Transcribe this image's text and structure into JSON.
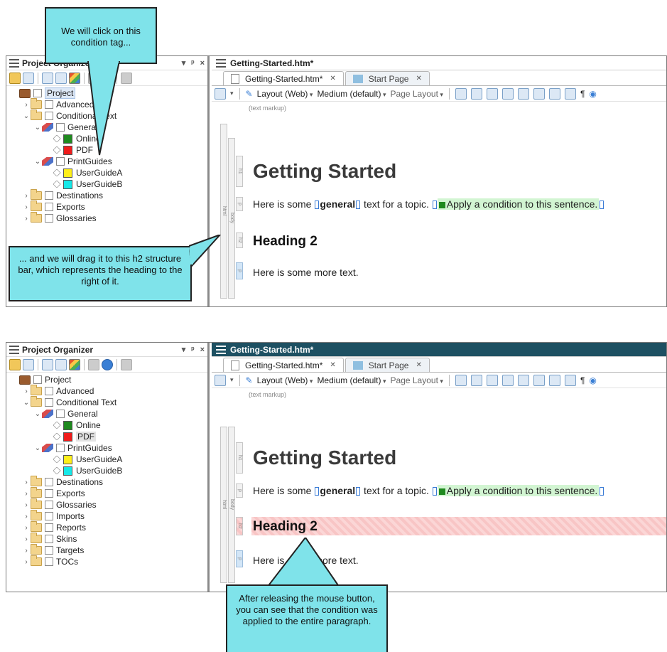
{
  "panels": [
    {
      "organizer": {
        "title": "Project Organizer",
        "pin": "ᵖ",
        "close": "×"
      },
      "tree": [
        {
          "label": "Project",
          "level": 0,
          "icon": "briefcase",
          "expanded": null
        },
        {
          "label": "Advanced",
          "level": 1,
          "icon": "folder",
          "expanded": false
        },
        {
          "label": "Conditional Text",
          "level": 1,
          "icon": "folder",
          "expanded": true
        },
        {
          "label": "General",
          "level": 2,
          "icon": "tagset",
          "expanded": true
        },
        {
          "label": "Online",
          "level": 3,
          "icon": "tag",
          "swatch": "#1f8a1f"
        },
        {
          "label": "PDF",
          "level": 3,
          "icon": "tag",
          "swatch": "#ef1c1c"
        },
        {
          "label": "PrintGuides",
          "level": 2,
          "icon": "tagset",
          "expanded": true
        },
        {
          "label": "UserGuideA",
          "level": 3,
          "icon": "tag",
          "swatch": "#ffef1a"
        },
        {
          "label": "UserGuideB",
          "level": 3,
          "icon": "tag",
          "swatch": "#16e8e8"
        },
        {
          "label": "Destinations",
          "level": 1,
          "icon": "folder",
          "expanded": false
        },
        {
          "label": "Exports",
          "level": 1,
          "icon": "folder",
          "expanded": false
        },
        {
          "label": "Glossaries",
          "level": 1,
          "icon": "folder",
          "expanded": false
        }
      ],
      "doc": {
        "header_title": "Getting-Started.htm*",
        "tab_active": "Getting-Started.htm*",
        "tab_inactive": "Start Page",
        "toolbar": {
          "layout": "Layout (Web)",
          "medium": "Medium (default)",
          "page_layout": "Page Layout",
          "pilcrow": "¶"
        },
        "markup_label": "(text markup)",
        "struct_labels": {
          "html": "html",
          "body": "body",
          "h1": "h1",
          "p": "p",
          "h2": "h2"
        },
        "h1": "Getting Started",
        "p1_before": "Here is some ",
        "p1_bold": "general",
        "p1_after": " text for a topic. ",
        "p1_cond": "Apply a condition to this sentence.",
        "h2": "Heading 2",
        "p2": "Here is some more text."
      },
      "callouts": {
        "top": "We will click on this condition tag...",
        "bottom": "... and we will drag it to this h2 structure bar, which represents the heading to the right of it."
      }
    },
    {
      "organizer": {
        "title": "Project Organizer",
        "pin": "ᵖ",
        "close": "×"
      },
      "tree": [
        {
          "label": "Project",
          "level": 0,
          "icon": "briefcase",
          "expanded": null
        },
        {
          "label": "Advanced",
          "level": 1,
          "icon": "folder",
          "expanded": false
        },
        {
          "label": "Conditional Text",
          "level": 1,
          "icon": "folder",
          "expanded": true
        },
        {
          "label": "General",
          "level": 2,
          "icon": "tagset",
          "expanded": true
        },
        {
          "label": "Online",
          "level": 3,
          "icon": "tag",
          "swatch": "#1f8a1f"
        },
        {
          "label": "PDF",
          "level": 3,
          "icon": "tag",
          "swatch": "#ef1c1c"
        },
        {
          "label": "PrintGuides",
          "level": 2,
          "icon": "tagset",
          "expanded": true
        },
        {
          "label": "UserGuideA",
          "level": 3,
          "icon": "tag",
          "swatch": "#ffef1a"
        },
        {
          "label": "UserGuideB",
          "level": 3,
          "icon": "tag",
          "swatch": "#16e8e8"
        },
        {
          "label": "Destinations",
          "level": 1,
          "icon": "folder",
          "expanded": false
        },
        {
          "label": "Exports",
          "level": 1,
          "icon": "folder",
          "expanded": false
        },
        {
          "label": "Glossaries",
          "level": 1,
          "icon": "folder",
          "expanded": false
        },
        {
          "label": "Imports",
          "level": 1,
          "icon": "folder",
          "expanded": false
        },
        {
          "label": "Reports",
          "level": 1,
          "icon": "folder",
          "expanded": false
        },
        {
          "label": "Skins",
          "level": 1,
          "icon": "folder",
          "expanded": false
        },
        {
          "label": "Targets",
          "level": 1,
          "icon": "folder",
          "expanded": false
        },
        {
          "label": "TOCs",
          "level": 1,
          "icon": "folder",
          "expanded": false
        }
      ],
      "doc": {
        "header_title": "Getting-Started.htm*",
        "tab_active": "Getting-Started.htm*",
        "tab_inactive": "Start Page",
        "toolbar": {
          "layout": "Layout (Web)",
          "medium": "Medium (default)",
          "page_layout": "Page Layout",
          "pilcrow": "¶"
        },
        "markup_label": "(text markup)",
        "struct_labels": {
          "html": "html",
          "body": "body",
          "h1": "h1",
          "p": "p",
          "h2": "h2"
        },
        "h1": "Getting Started",
        "p1_before": "Here is some ",
        "p1_bold": "general",
        "p1_after": " text for a topic. ",
        "p1_cond": "Apply a condition to this sentence.",
        "h2": "Heading 2",
        "p2": "Here is some more text."
      },
      "callouts": {
        "bottom": "After releasing the mouse button, you can see that the condition was applied to the entire paragraph."
      }
    }
  ],
  "colors": {
    "callout": "#7fe3ea",
    "active_header": "#1d5062",
    "condition_highlight": "#d2f5d2",
    "pdf_hatch": "#fbd6d6"
  }
}
